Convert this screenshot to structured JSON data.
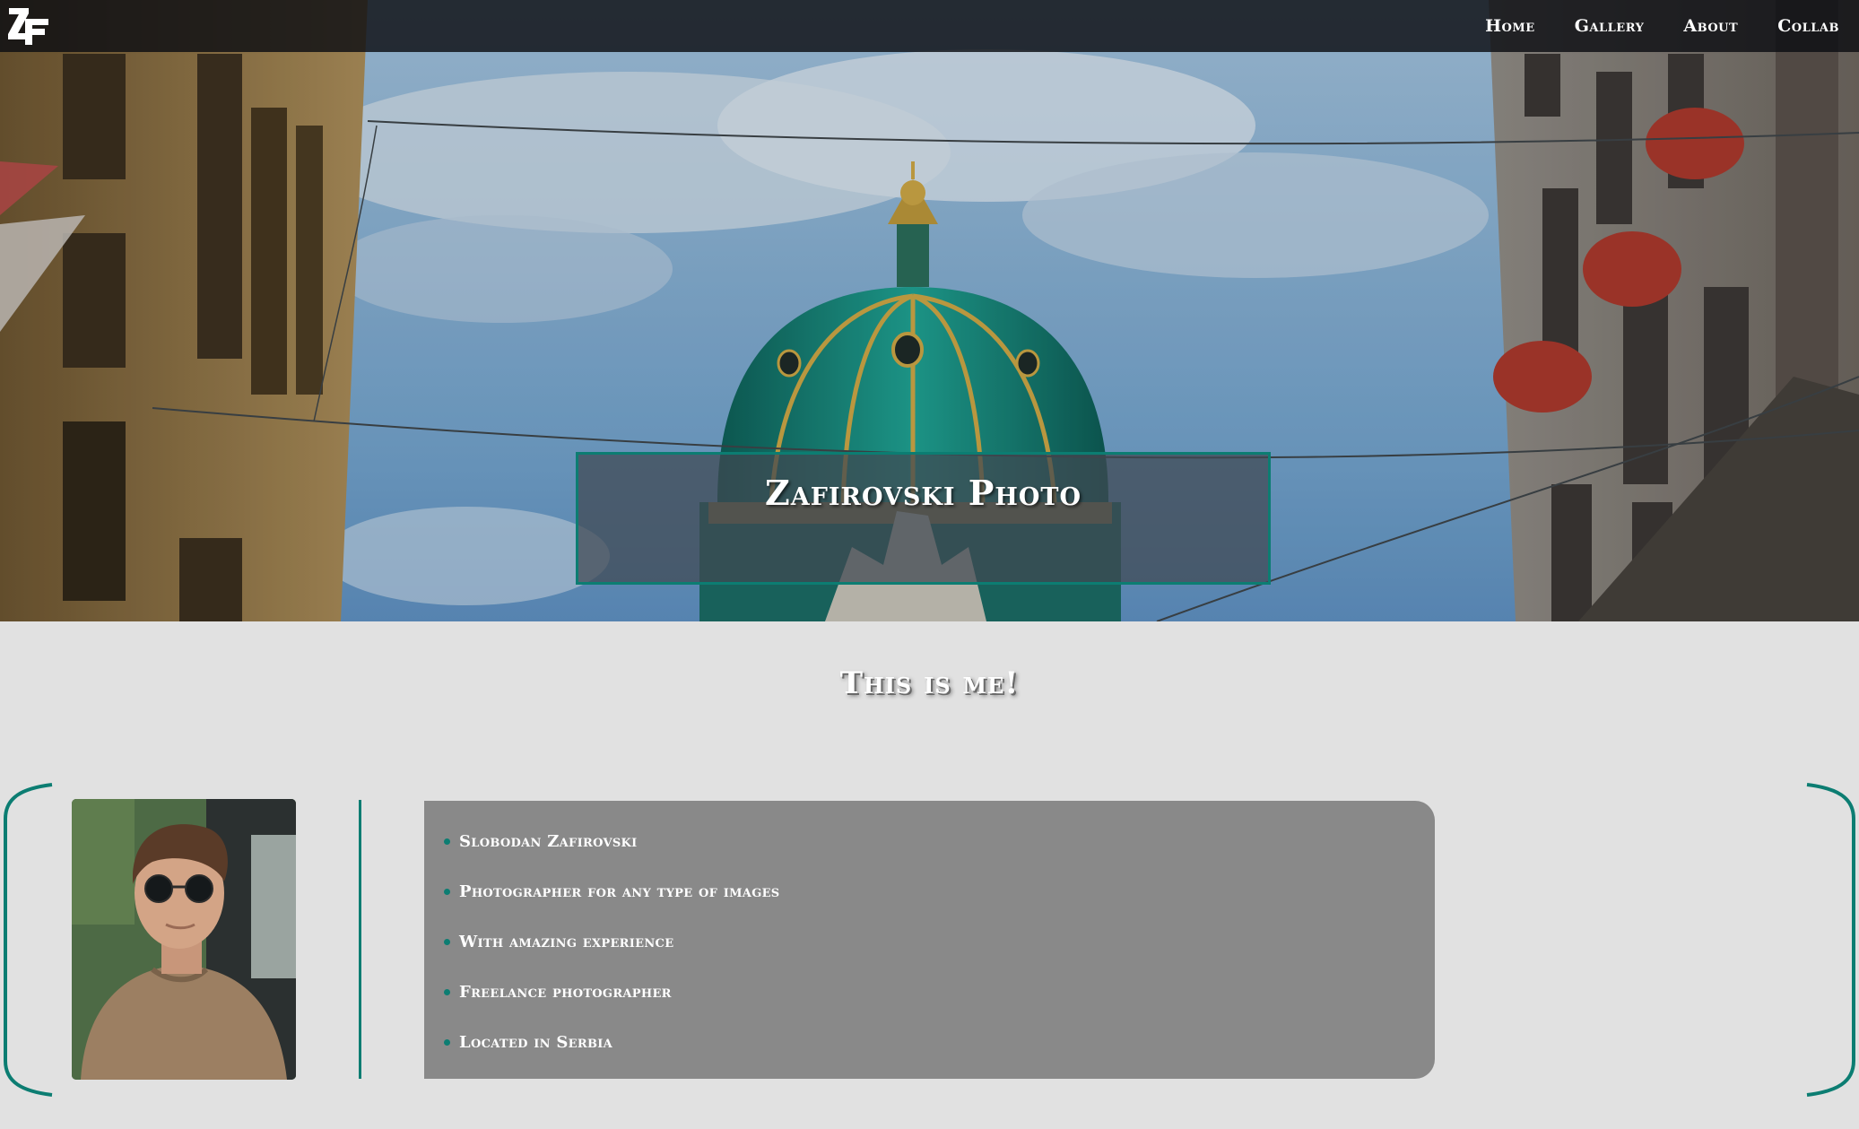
{
  "colors": {
    "accent": "#0c7d72",
    "background": "#e1e1e1",
    "card": "#898989",
    "navbar": "#0c0e12"
  },
  "logo": {
    "text": "ZF",
    "icon": "zf-logo-icon"
  },
  "nav": {
    "items": [
      {
        "label": "Home"
      },
      {
        "label": "Gallery"
      },
      {
        "label": "About"
      },
      {
        "label": "Collab"
      }
    ]
  },
  "hero": {
    "title": "Zafirovski Photo",
    "image": "hero-photo-dome-icon"
  },
  "about": {
    "heading": "This is me!",
    "portrait": "portrait-photo-icon",
    "facts": [
      "Slobodan Zafirovski",
      "Photographer for any type of images",
      "With amazing experience",
      "Freelance photographer",
      "Located in Serbia"
    ]
  }
}
